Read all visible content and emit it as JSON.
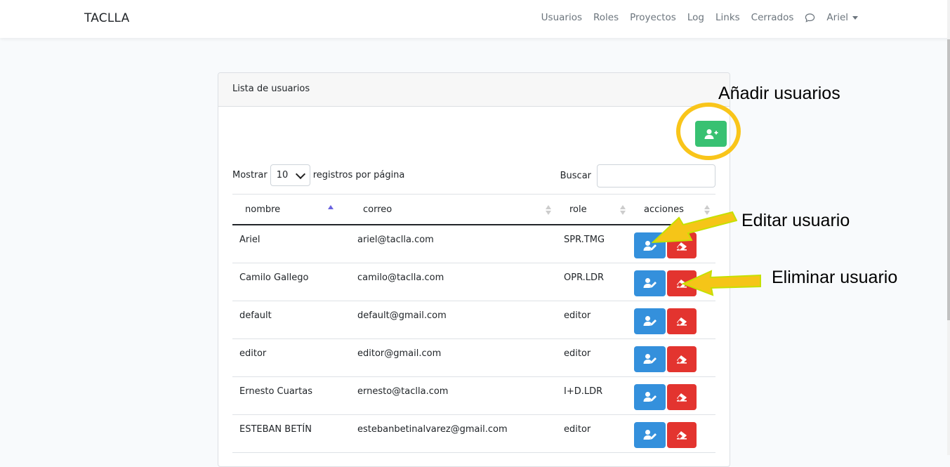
{
  "navbar": {
    "brand": "TACLLA",
    "links": [
      "Usuarios",
      "Roles",
      "Proyectos",
      "Log",
      "Links",
      "Cerrados"
    ],
    "user": "Ariel"
  },
  "card": {
    "title": "Lista de usuarios",
    "show_label": "Mostrar",
    "page_size": "10",
    "per_page_label": "registros por página",
    "search_label": "Buscar",
    "search_value": ""
  },
  "table": {
    "columns": [
      "nombre",
      "correo",
      "role",
      "acciones"
    ],
    "rows": [
      {
        "nombre": "Ariel",
        "correo": "ariel@taclla.com",
        "role": "SPR.TMG"
      },
      {
        "nombre": "Camilo Gallego",
        "correo": "camilo@taclla.com",
        "role": "OPR.LDR"
      },
      {
        "nombre": "default",
        "correo": "default@gmail.com",
        "role": "editor"
      },
      {
        "nombre": "editor",
        "correo": "editor@gmail.com",
        "role": "editor"
      },
      {
        "nombre": "Ernesto Cuartas",
        "correo": "ernesto@taclla.com",
        "role": "I+D.LDR"
      },
      {
        "nombre": "ESTEBAN BETÍN",
        "correo": "estebanbetinalvarez@gmail.com",
        "role": "editor"
      }
    ]
  },
  "annotations": {
    "add": "Añadir usuarios",
    "edit": "Editar usuario",
    "delete": "Eliminar usuario"
  },
  "colors": {
    "add_button": "#38c172",
    "edit_button": "#3490dc",
    "delete_button": "#e3342f",
    "highlight": "#f9c51a",
    "arrow": "#f5c518"
  }
}
